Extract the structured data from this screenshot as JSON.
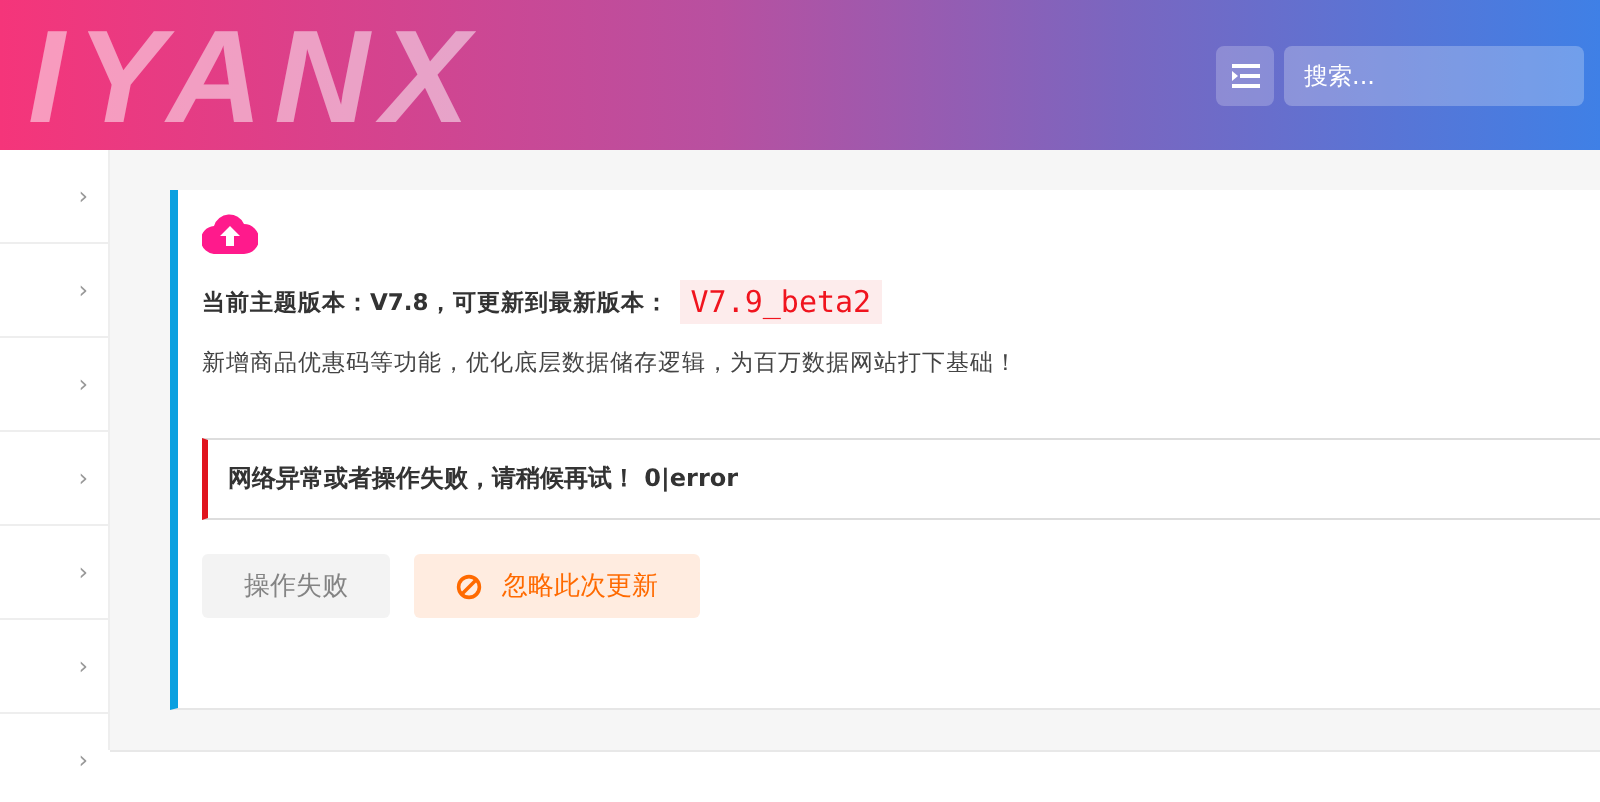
{
  "header": {
    "logo_text": "IYANX",
    "search": {
      "placeholder": "搜索..."
    }
  },
  "sidebar": {
    "items": [
      {
        "chevron": "›"
      },
      {
        "chevron": "›"
      },
      {
        "chevron": "›"
      },
      {
        "chevron": "›"
      },
      {
        "chevron": "›"
      },
      {
        "chevron": "›"
      },
      {
        "chevron": "›"
      }
    ]
  },
  "update_card": {
    "version_label": "当前主题版本：V7.8，可更新到最新版本：",
    "new_version": "V7.9_beta2",
    "description": "新增商品优惠码等功能，优化底层数据储存逻辑，为百万数据网站打下基础！",
    "alert": {
      "message": "网络异常或者操作失败，请稍候再试！ 0|error"
    },
    "buttons": [
      {
        "kind": "status",
        "label": "操作失败",
        "disabled": true
      },
      {
        "kind": "ignore",
        "label": "忽略此次更新",
        "disabled": false
      }
    ]
  }
}
